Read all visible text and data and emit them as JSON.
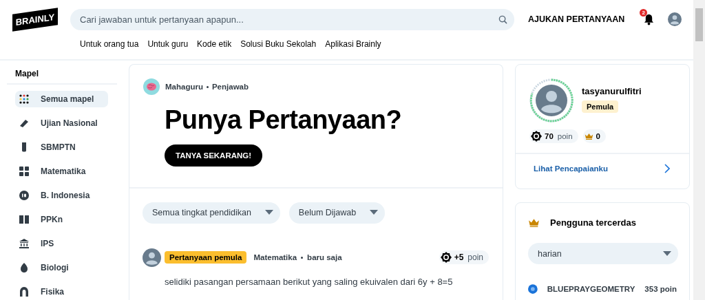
{
  "header": {
    "logo": "BRAINLY",
    "search": {
      "placeholder": "Cari jawaban untuk pertanyaan apapun..."
    },
    "ask_button": "AJUKAN PERTANYAAN",
    "notification_count": "2",
    "nav_links": [
      "Untuk orang tua",
      "Untuk guru",
      "Kode etik",
      "Solusi Buku Sekolah",
      "Aplikasi Brainly"
    ]
  },
  "sidebar": {
    "title": "Mapel",
    "items": [
      {
        "label": "Semua mapel",
        "selected": true
      },
      {
        "label": "Ujian Nasional",
        "selected": false
      },
      {
        "label": "SBMPTN",
        "selected": false
      },
      {
        "label": "Matematika",
        "selected": false
      },
      {
        "label": "B. Indonesia",
        "selected": false
      },
      {
        "label": "PPKn",
        "selected": false
      },
      {
        "label": "IPS",
        "selected": false
      },
      {
        "label": "Biologi",
        "selected": false
      },
      {
        "label": "Fisika",
        "selected": false
      }
    ]
  },
  "hero": {
    "author": "Mahaguru",
    "role": "Penjawab",
    "title": "Punya Pertanyaan?",
    "button": "TANYA SEKARANG!"
  },
  "filters": [
    "Semua tingkat pendidikan",
    "Belum Dijawab"
  ],
  "questions": [
    {
      "badge": "Pertanyaan pemula",
      "subject": "Matematika",
      "time": "baru saja",
      "points": "+5",
      "points_unit": "poin",
      "text": "selidiki pasangan persamaan berikut yang saling ekuivalen dari 6y + 8=5"
    }
  ],
  "profile": {
    "username": "tasyanurulfitri",
    "rank": "Pemula",
    "points": "70",
    "points_unit": "poin",
    "crowns": "0",
    "link": "Lihat Pencapaianku"
  },
  "leaderboard": {
    "title": "Pengguna tercerdas",
    "period": "harian",
    "users": [
      {
        "name": "BLUEPRAYGEOMETRY",
        "points": "353 poin"
      }
    ]
  }
}
